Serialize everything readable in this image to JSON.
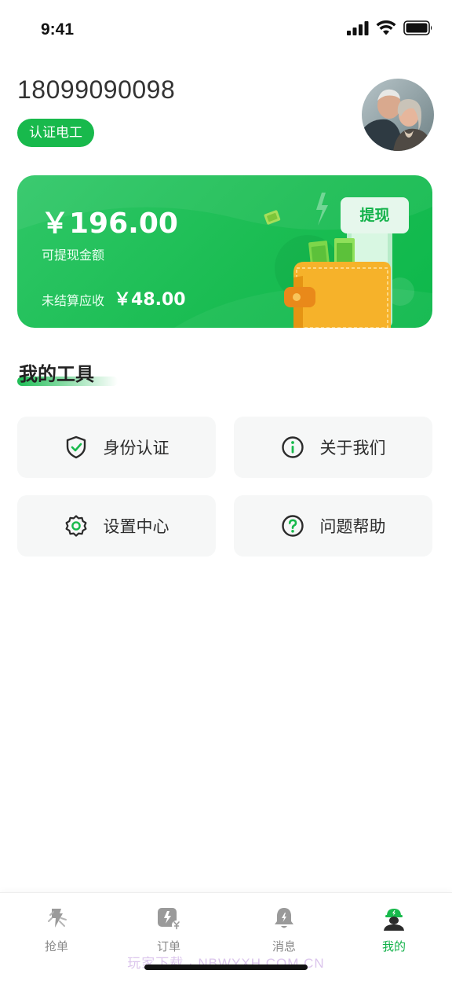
{
  "status_bar": {
    "time": "9:41",
    "icons": [
      "signal-icon",
      "wifi-icon",
      "battery-icon"
    ]
  },
  "profile": {
    "phone": "18099090098",
    "badge": "认证电工"
  },
  "balance": {
    "amount": "￥196.00",
    "label": "可提现金额",
    "pending_label": "未结算应收",
    "pending_amount": "￥48.00",
    "withdraw_label": "提现"
  },
  "tools": {
    "title": "我的工具",
    "items": [
      {
        "label": "身份认证",
        "icon": "shield-check-icon"
      },
      {
        "label": "关于我们",
        "icon": "info-icon"
      },
      {
        "label": "设置中心",
        "icon": "gear-icon"
      },
      {
        "label": "问题帮助",
        "icon": "question-icon"
      }
    ]
  },
  "tab_bar": {
    "items": [
      {
        "label": "抢单",
        "icon": "grab-order-icon"
      },
      {
        "label": "订单",
        "icon": "order-icon"
      },
      {
        "label": "消息",
        "icon": "bell-icon"
      },
      {
        "label": "我的",
        "icon": "worker-icon",
        "active": true
      }
    ]
  },
  "watermark": "玩家下载 · NBWYXH.COM.CN",
  "colors": {
    "accent": "#18b94c",
    "tool_card_bg": "#f6f7f7",
    "text_primary": "#2c2c2c",
    "tab_inactive": "#8a8a8a"
  }
}
